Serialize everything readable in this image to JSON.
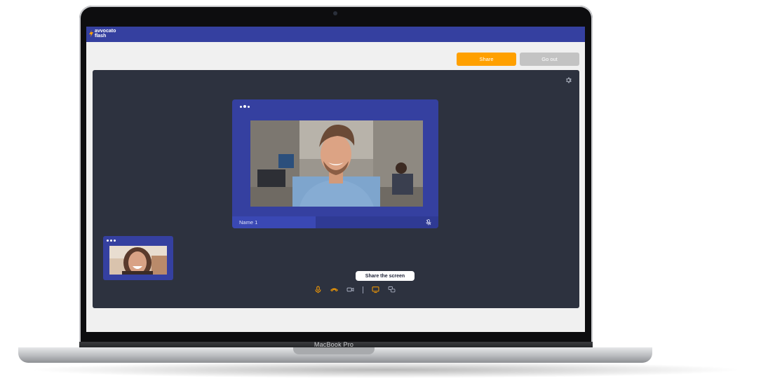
{
  "device": {
    "brand_label": "MacBook Pro"
  },
  "app": {
    "logo_line1": "avvocato",
    "logo_line2": "flash",
    "brand_color": "#3540a0"
  },
  "toolbar": {
    "share_label": "Share",
    "go_out_label": "Go out",
    "accent": "#ffa000"
  },
  "call": {
    "main_participant": {
      "name": "Name 1",
      "muted": true
    },
    "thumbnail_participant": {
      "muted": false
    },
    "tooltip": "Share the screen",
    "controls": [
      "microphone-icon",
      "hang-up-icon",
      "camera-icon",
      "screen-share-icon",
      "chat-icon"
    ],
    "settings_icon": "gear-icon"
  }
}
